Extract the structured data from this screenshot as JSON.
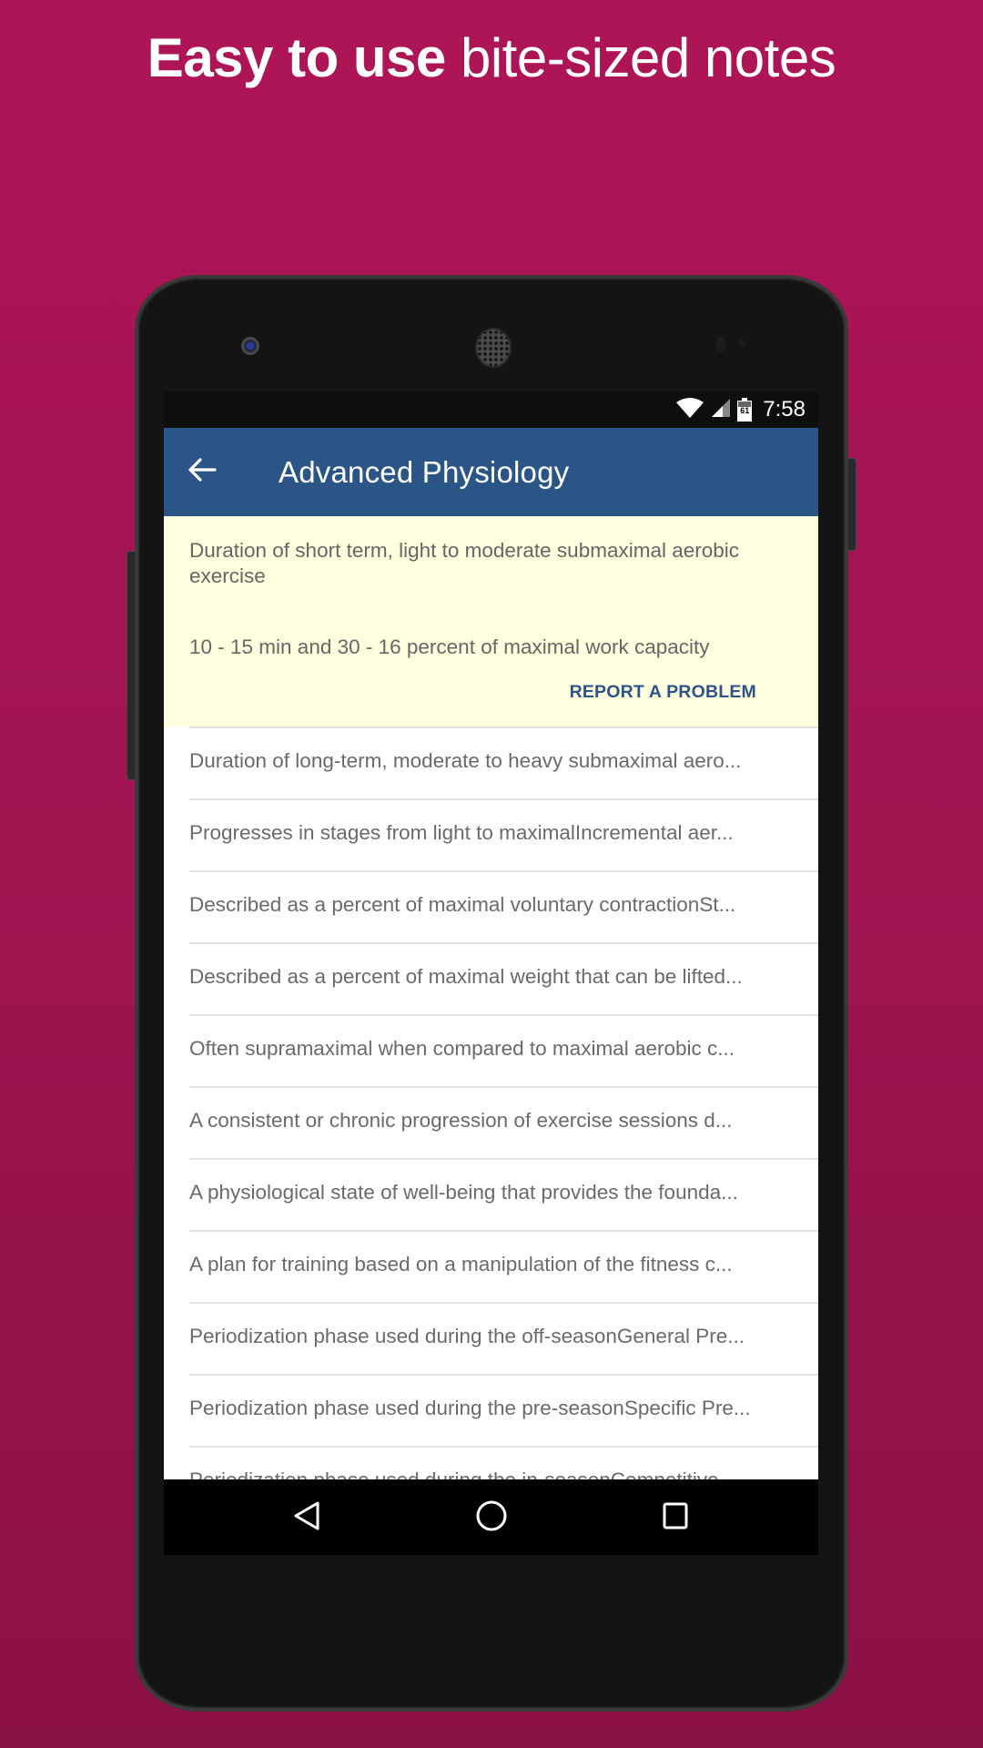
{
  "promo": {
    "headline_bold": "Easy to use",
    "headline_light": "bite-sized notes",
    "background_top": "#AE1557",
    "background_bottom": "#8A1145"
  },
  "status_bar": {
    "icons": [
      "wifi-icon",
      "cell-signal-icon",
      "battery-icon"
    ],
    "battery_level": "61",
    "time": "7:58"
  },
  "app_bar": {
    "back_icon": "arrow-left-icon",
    "title": "Advanced Physiology",
    "color": "#2C5587"
  },
  "expanded_card": {
    "question": "Duration of short term, light to moderate submaximal aerobic exercise",
    "answer": "10 - 15 min and 30 - 16 percent of maximal work capacity",
    "report_label": "REPORT A PROBLEM",
    "background": "#FFFFE0"
  },
  "list": {
    "items": [
      "Duration of long-term, moderate to heavy submaximal aero...",
      "Progresses in stages from light to maximalIncremental aer...",
      "Described as a percent of maximal voluntary contractionSt...",
      "Described as a percent of maximal weight that can be lifted...",
      "Often supramaximal when compared to maximal aerobic c...",
      "A consistent or chronic progression of exercise sessions d...",
      "A physiological state of well-being that provides the founda...",
      "A plan for training based on a manipulation of the fitness c...",
      "Periodization phase used during the off-seasonGeneral Pre...",
      "Periodization phase used during the pre-seasonSpecific Pre...",
      "Periodization phase used during the in-seasonCompetitive..."
    ]
  },
  "nav_bar": {
    "back": "triangle-back-icon",
    "home": "circle-home-icon",
    "recents": "square-recents-icon"
  }
}
